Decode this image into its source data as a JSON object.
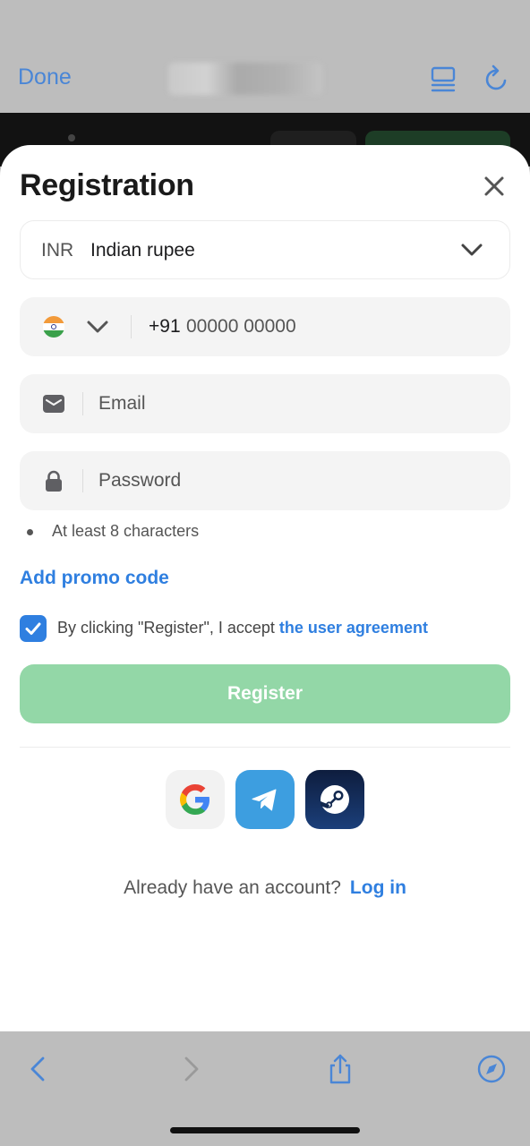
{
  "browser": {
    "done_label": "Done",
    "icons": {
      "reader": "reader-view-icon",
      "reload": "reload-icon",
      "back": "back-icon",
      "forward": "forward-icon",
      "share": "share-icon",
      "compass": "compass-icon"
    }
  },
  "registration": {
    "title": "Registration",
    "currency": {
      "code": "INR",
      "name": "Indian rupee"
    },
    "phone": {
      "prefix": "+91",
      "placeholder": "00000 00000"
    },
    "email": {
      "placeholder": "Email"
    },
    "password": {
      "placeholder": "Password",
      "hint": "At least 8 characters"
    },
    "promo_label": "Add promo code",
    "agreement": {
      "checked": true,
      "text": "By clicking \"Register\", I accept",
      "link": "the user agreement"
    },
    "register_label": "Register",
    "social": [
      "Google",
      "Telegram",
      "Steam"
    ],
    "login": {
      "question": "Already have an account?",
      "link": "Log in"
    }
  },
  "colors": {
    "accent": "#2f7fe0",
    "register_button": "#93d7a7",
    "browser_chrome": "#bdbdbd"
  }
}
